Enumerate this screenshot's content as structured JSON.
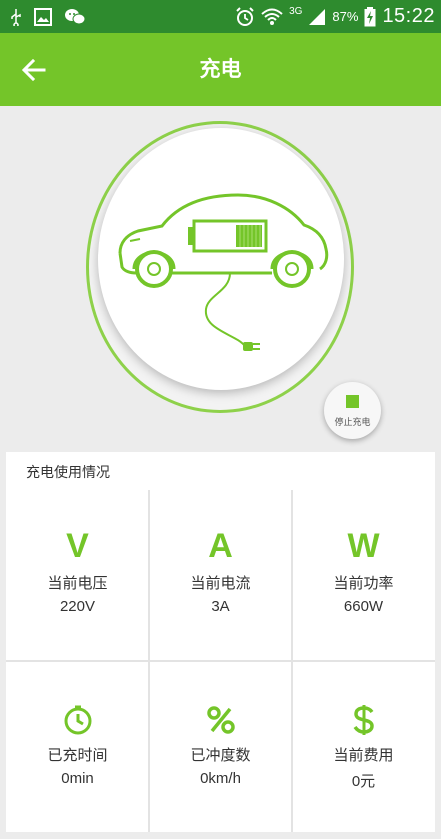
{
  "status_bar": {
    "network": "3G",
    "battery": "87%",
    "time": "15:22",
    "left_icons": [
      "usb-icon",
      "image-icon",
      "wechat-icon"
    ],
    "right_icons": [
      "alarm-icon",
      "wifi-icon",
      "signal-icon",
      "battery-charging-icon"
    ]
  },
  "header": {
    "title": "充电",
    "back_icon": "arrow-left-icon"
  },
  "charging": {
    "car_icon": "electric-car-icon",
    "stop_button_label": "停止充电"
  },
  "usage": {
    "section_title": "充电使用情况",
    "items": [
      {
        "icon_letter": "V",
        "label": "当前电压",
        "value": "220V"
      },
      {
        "icon_letter": "A",
        "label": "当前电流",
        "value": "3A"
      },
      {
        "icon_letter": "W",
        "label": "当前功率",
        "value": "660W"
      },
      {
        "icon": "clock-icon",
        "label": "已充时间",
        "value": "0min"
      },
      {
        "icon": "percent-icon",
        "label": "已冲度数",
        "value": "0km/h"
      },
      {
        "icon": "dollar-icon",
        "label": "当前费用",
        "value": "0元"
      }
    ]
  },
  "colors": {
    "status_bar": "#2e8b2e",
    "accent_green": "#74c529",
    "background": "#ececec"
  }
}
